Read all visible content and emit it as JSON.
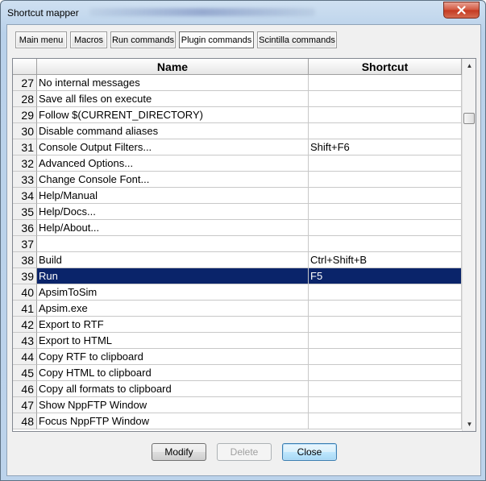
{
  "window": {
    "title": "Shortcut mapper"
  },
  "tabs": [
    {
      "label": "Main menu"
    },
    {
      "label": "Macros"
    },
    {
      "label": "Run commands"
    },
    {
      "label": "Plugin commands"
    },
    {
      "label": "Scintilla commands"
    }
  ],
  "active_tab": "Plugin commands",
  "grid": {
    "columns": {
      "name": "Name",
      "shortcut": "Shortcut"
    },
    "rows": [
      {
        "num": "27",
        "name": "No internal messages",
        "shortcut": ""
      },
      {
        "num": "28",
        "name": "Save all files on execute",
        "shortcut": ""
      },
      {
        "num": "29",
        "name": "Follow $(CURRENT_DIRECTORY)",
        "shortcut": ""
      },
      {
        "num": "30",
        "name": "Disable command aliases",
        "shortcut": ""
      },
      {
        "num": "31",
        "name": "Console Output Filters...",
        "shortcut": "Shift+F6"
      },
      {
        "num": "32",
        "name": "Advanced Options...",
        "shortcut": ""
      },
      {
        "num": "33",
        "name": "Change Console Font...",
        "shortcut": ""
      },
      {
        "num": "34",
        "name": "Help/Manual",
        "shortcut": ""
      },
      {
        "num": "35",
        "name": "Help/Docs...",
        "shortcut": ""
      },
      {
        "num": "36",
        "name": "Help/About...",
        "shortcut": ""
      },
      {
        "num": "37",
        "name": "",
        "shortcut": ""
      },
      {
        "num": "38",
        "name": "Build",
        "shortcut": "Ctrl+Shift+B"
      },
      {
        "num": "39",
        "name": "Run",
        "shortcut": "F5"
      },
      {
        "num": "40",
        "name": "ApsimToSim",
        "shortcut": ""
      },
      {
        "num": "41",
        "name": "Apsim.exe",
        "shortcut": ""
      },
      {
        "num": "42",
        "name": "Export to RTF",
        "shortcut": ""
      },
      {
        "num": "43",
        "name": "Export to HTML",
        "shortcut": ""
      },
      {
        "num": "44",
        "name": "Copy RTF to clipboard",
        "shortcut": ""
      },
      {
        "num": "45",
        "name": "Copy HTML to clipboard",
        "shortcut": ""
      },
      {
        "num": "46",
        "name": "Copy all formats to clipboard",
        "shortcut": ""
      },
      {
        "num": "47",
        "name": "Show NppFTP Window",
        "shortcut": ""
      },
      {
        "num": "48",
        "name": "Focus NppFTP Window",
        "shortcut": ""
      }
    ],
    "selected_row": "39"
  },
  "buttons": {
    "modify": "Modify",
    "delete": "Delete",
    "close": "Close"
  },
  "colors": {
    "selection": "#0a246a",
    "selection_text": "#ffffff"
  }
}
